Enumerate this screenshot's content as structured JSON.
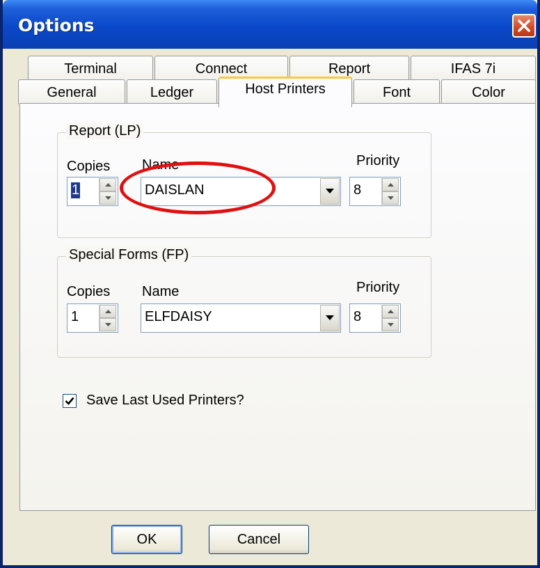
{
  "window": {
    "title": "Options"
  },
  "tabs": {
    "back_row": [
      "Terminal",
      "Connect",
      "Report",
      "IFAS 7i"
    ],
    "front_row": [
      "General",
      "Ledger",
      "Host Printers",
      "Font",
      "Color"
    ],
    "selected": "Host Printers"
  },
  "report_group": {
    "label": "Report (LP)",
    "copies_label": "Copies",
    "name_label": "Name",
    "priority_label": "Priority",
    "copies_value": "1",
    "name_value": "DAISLAN",
    "priority_value": "8"
  },
  "special_group": {
    "label": "Special Forms (FP)",
    "copies_label": "Copies",
    "name_label": "Name",
    "priority_label": "Priority",
    "copies_value": "1",
    "name_value": "ELFDAISY",
    "priority_value": "8"
  },
  "save_last": {
    "label": "Save Last Used Printers?",
    "checked": true
  },
  "buttons": {
    "ok": "OK",
    "cancel": "Cancel"
  },
  "colors": {
    "title_bar": "#0a48c9",
    "close": "#cf4a25",
    "highlight_ellipse": "#e01010",
    "tab_accent": "#ffc83c"
  },
  "icons": [
    "close-icon",
    "spin-up-icon",
    "spin-down-icon",
    "dropdown-arrow-icon",
    "checkmark-icon"
  ]
}
